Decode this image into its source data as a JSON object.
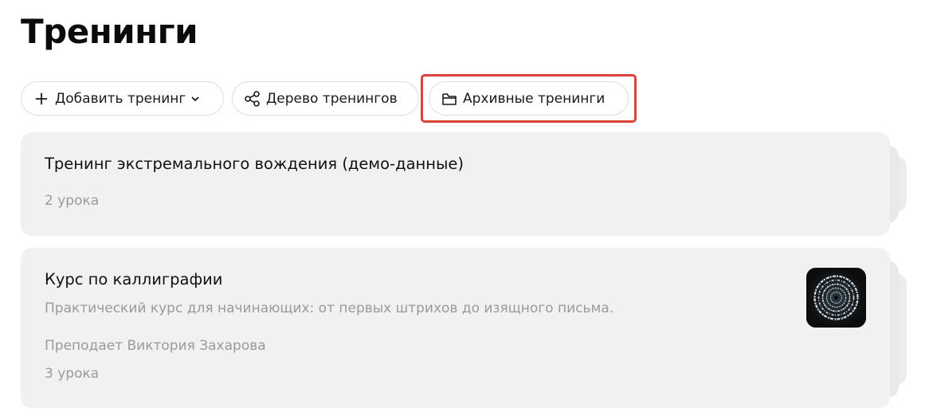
{
  "page": {
    "title": "Тренинги"
  },
  "toolbar": {
    "add_label": "Добавить тренинг",
    "add_icon": "plus-icon",
    "add_chevron_icon": "chevron-down-icon",
    "tree_label": "Дерево тренингов",
    "tree_icon": "share-nodes-icon",
    "archive_label": "Архивные тренинги",
    "archive_icon": "folder-icon",
    "highlight_color": "#d9433a"
  },
  "trainings": [
    {
      "title": "Тренинг экстремального вождения (демо-данные)",
      "lessons": "2 урока"
    },
    {
      "title": "Курс по каллиграфии",
      "description": "Практический курс для начинающих: от первых штрихов до изящного письма.",
      "teacher": "Преподает Виктория Захарова",
      "lessons": "3 урока",
      "has_thumbnail": true
    }
  ],
  "colors": {
    "card_bg": "#f1f1f1",
    "meta_text": "#9a9a9a",
    "title_text": "#0b0b0b"
  }
}
